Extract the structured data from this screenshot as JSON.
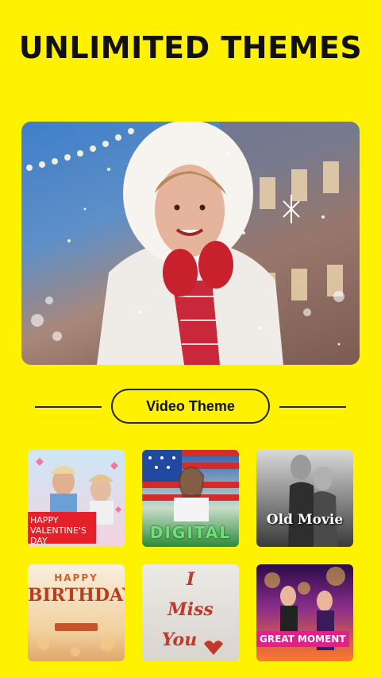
{
  "headline": "UNLIMITED THEMES",
  "section": {
    "button_label": "Video Theme"
  },
  "themes": [
    {
      "name": "valentines",
      "caption": "HAPPY VALENTINE'S DAY"
    },
    {
      "name": "digital",
      "caption": "DIGITAL"
    },
    {
      "name": "old-movie",
      "caption": "Old Movie"
    },
    {
      "name": "birthday",
      "caption_small": "HAPPY",
      "caption_large": "BIRTHDAY"
    },
    {
      "name": "miss-you",
      "caption_1": "I",
      "caption_2": "Miss",
      "caption_3": "You"
    },
    {
      "name": "great-moment",
      "caption": "GREAT MOMENT"
    }
  ],
  "colors": {
    "background": "#FFF200",
    "text": "#111111",
    "accent_red": "#E5202B"
  }
}
